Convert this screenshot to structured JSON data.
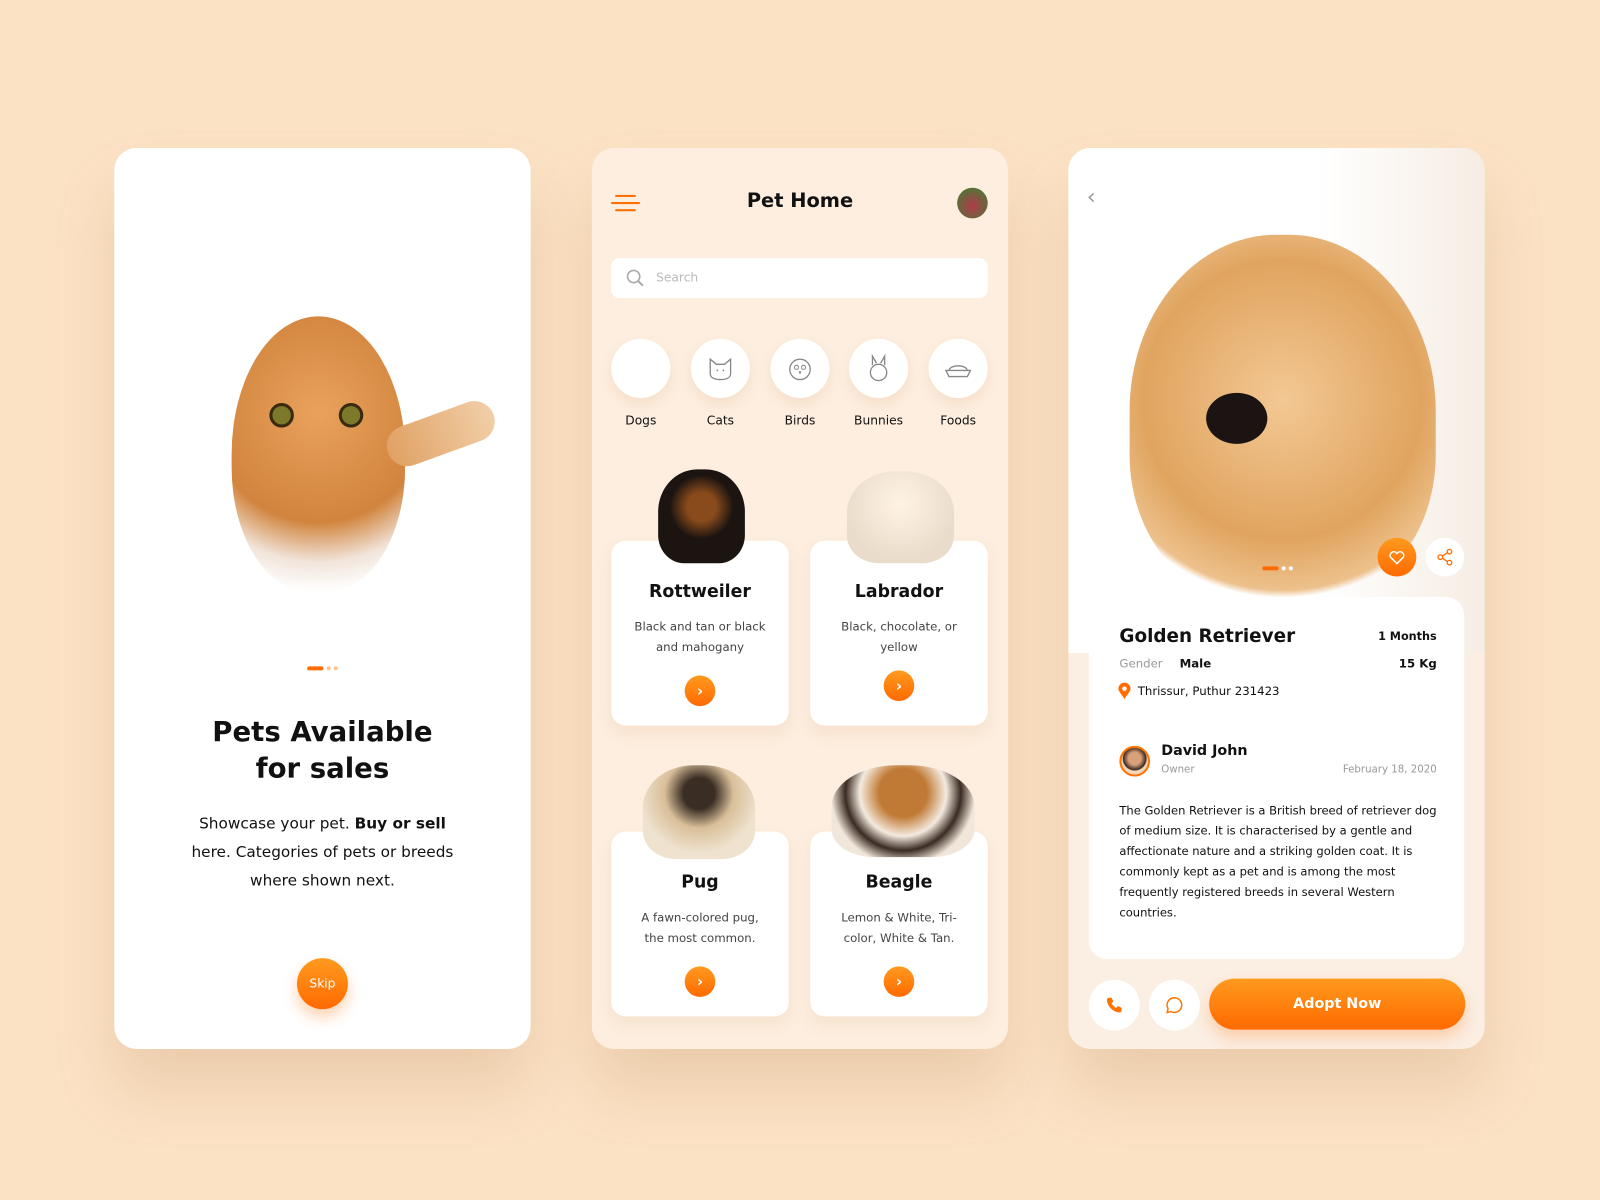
{
  "onboarding": {
    "title_line1": "Pets Available",
    "title_line2": "for sales",
    "body_a": "Showcase your pet. ",
    "body_b": "Buy or sell",
    "body_c": " here. Categories of pets or breeds where shown next.",
    "skip": "Skip",
    "page_index": 1,
    "page_count": 3
  },
  "home": {
    "title": "Pet Home",
    "search_placeholder": "Search",
    "categories": [
      {
        "label": "Dogs",
        "icon": "dog-icon",
        "active": true
      },
      {
        "label": "Cats",
        "icon": "cat-icon"
      },
      {
        "label": "Birds",
        "icon": "bird-icon"
      },
      {
        "label": "Bunnies",
        "icon": "bunny-icon"
      },
      {
        "label": "Foods",
        "icon": "food-bowl-icon"
      }
    ],
    "pets": [
      {
        "name": "Rottweiler",
        "desc": "Black and tan or black and mahogany"
      },
      {
        "name": "Labrador",
        "desc": "Black, chocolate, or yellow"
      },
      {
        "name": "Pug",
        "desc": "A fawn-colored pug, the most common."
      },
      {
        "name": "Beagle",
        "desc": "Lemon & White, Tri-color, White & Tan."
      }
    ]
  },
  "detail": {
    "name": "Golden Retriever",
    "age": "1 Months",
    "gender_label": "Gender",
    "gender": "Male",
    "weight": "15 Kg",
    "location": "Thrissur, Puthur 231423",
    "owner_name": "David John",
    "owner_role": "Owner",
    "date": "February 18, 2020",
    "description": "The Golden Retriever is a British breed of retriever dog of medium size. It is characterised by a gentle and affectionate nature and a striking golden coat. It is commonly kept as a pet and is among the most frequently registered breeds in several Western countries.",
    "adopt": "Adopt Now",
    "image_index": 1,
    "image_count": 3
  },
  "colors": {
    "accent": "#ff7300",
    "background": "#fce2c5",
    "panel": "#fdeedf"
  }
}
